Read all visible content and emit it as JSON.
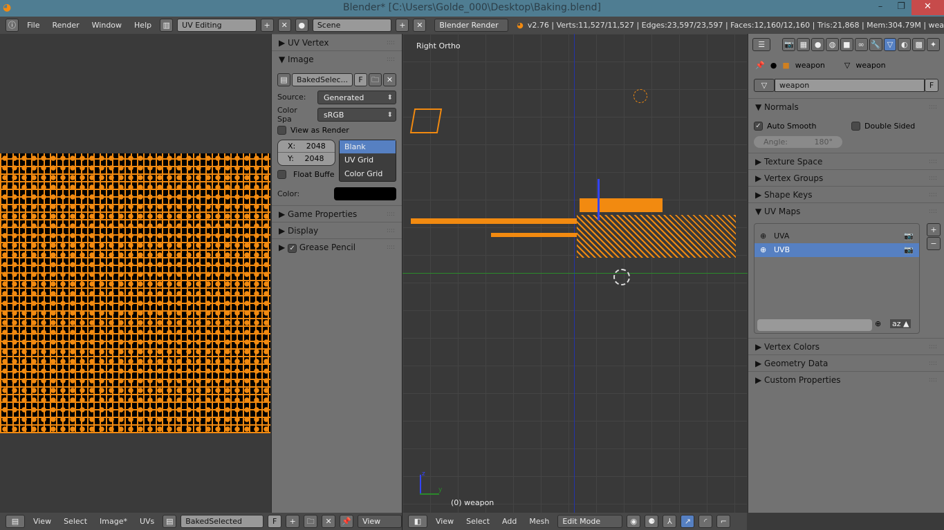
{
  "window": {
    "title": "Blender* [C:\\Users\\Golde_000\\Desktop\\Baking.blend]",
    "minimize": "–",
    "maximize": "❐",
    "close": "✕"
  },
  "topbar": {
    "menus": [
      "File",
      "Render",
      "Window",
      "Help"
    ],
    "screen_layout": "UV Editing",
    "scene": "Scene",
    "engine": "Blender Render",
    "stats": "v2.76 | Verts:11,527/11,527 | Edges:23,597/23,597 | Faces:12,160/12,160 | Tris:21,868 | Mem:304.79M | wea"
  },
  "tools": {
    "uv_vertex": "UV Vertex",
    "image": "Image",
    "image_name": "BakedSelec...",
    "fake_user": "F",
    "source_label": "Source:",
    "source": "Generated",
    "colorspace_label": "Color Spa",
    "colorspace": "sRGB",
    "view_as_render": "View as Render",
    "x_label": "X:",
    "x": "2048",
    "y_label": "Y:",
    "y": "2048",
    "float_buffer": "Float Buffe",
    "types": [
      "Blank",
      "UV Grid",
      "Color Grid"
    ],
    "selected_type": "Blank",
    "color_label": "Color:",
    "color": "#000000",
    "game_properties": "Game Properties",
    "display": "Display",
    "grease_pencil": "Grease Pencil"
  },
  "viewport": {
    "view_name": "Right Ortho",
    "object_label": "(0) weapon",
    "axis_x": "y",
    "axis_z": "z"
  },
  "properties": {
    "breadcrumb": [
      "weapon",
      "weapon"
    ],
    "mesh_name": "weapon",
    "fake_user": "F",
    "normals": "Normals",
    "auto_smooth": "Auto Smooth",
    "double_sided": "Double Sided",
    "angle_label": "Angle:",
    "angle": "180°",
    "texture_space": "Texture Space",
    "vertex_groups": "Vertex Groups",
    "shape_keys": "Shape Keys",
    "uv_maps": "UV Maps",
    "uv_list": [
      "UVA",
      "UVB"
    ],
    "selected_uv": "UVB",
    "vertex_colors": "Vertex Colors",
    "geometry_data": "Geometry Data",
    "custom_properties": "Custom Properties"
  },
  "uv_header": {
    "menus": [
      "View",
      "Select",
      "Image*",
      "UVs"
    ],
    "image": "BakedSelected",
    "fake_user": "F",
    "view": "View"
  },
  "view3d_header": {
    "menus": [
      "View",
      "Select",
      "Add",
      "Mesh"
    ],
    "mode": "Edit Mode"
  },
  "colors": {
    "accent": "#5680c2",
    "uv_wire": "#f28a10",
    "titlebar": "#4f7d92"
  }
}
